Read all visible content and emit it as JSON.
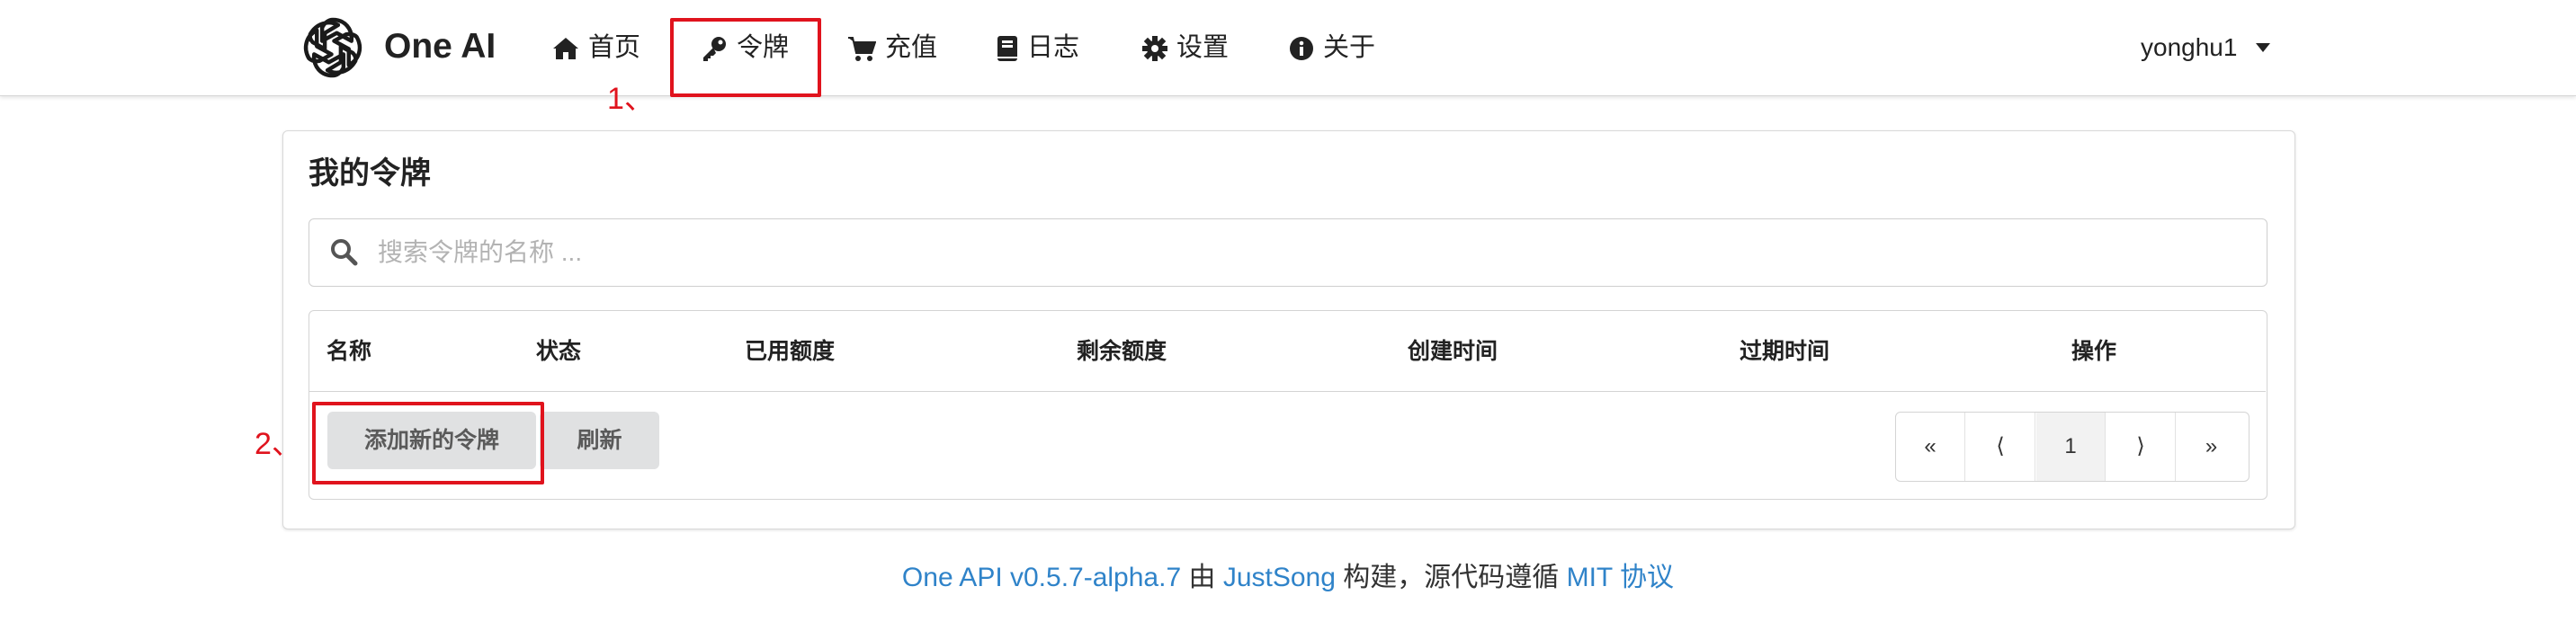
{
  "navbar": {
    "brand": "One AI",
    "items": [
      {
        "label": "首页",
        "icon": "home-icon"
      },
      {
        "label": "令牌",
        "icon": "key-icon"
      },
      {
        "label": "充值",
        "icon": "cart-icon"
      },
      {
        "label": "日志",
        "icon": "book-icon"
      },
      {
        "label": "设置",
        "icon": "gear-icon"
      },
      {
        "label": "关于",
        "icon": "info-icon"
      }
    ],
    "user": "yonghu1"
  },
  "annotations": {
    "step1": "1、",
    "step2": "2、",
    "color": "#e0131d"
  },
  "page": {
    "title": "我的令牌",
    "search_placeholder": "搜索令牌的名称 ..."
  },
  "table": {
    "columns": [
      "名称",
      "状态",
      "已用额度",
      "剩余额度",
      "创建时间",
      "过期时间",
      "操作"
    ],
    "rows": []
  },
  "actions": {
    "add_label": "添加新的令牌",
    "refresh_label": "刷新"
  },
  "pagination": {
    "first": "«",
    "prev": "⟨",
    "current": "1",
    "next": "⟩",
    "last": "»"
  },
  "footer": {
    "product": "One API v0.5.7-alpha.7",
    "by": "由",
    "author": "JustSong",
    "built": "构建，源代码遵循",
    "license": "MIT 协议",
    "link_color": "#2f83c9"
  }
}
